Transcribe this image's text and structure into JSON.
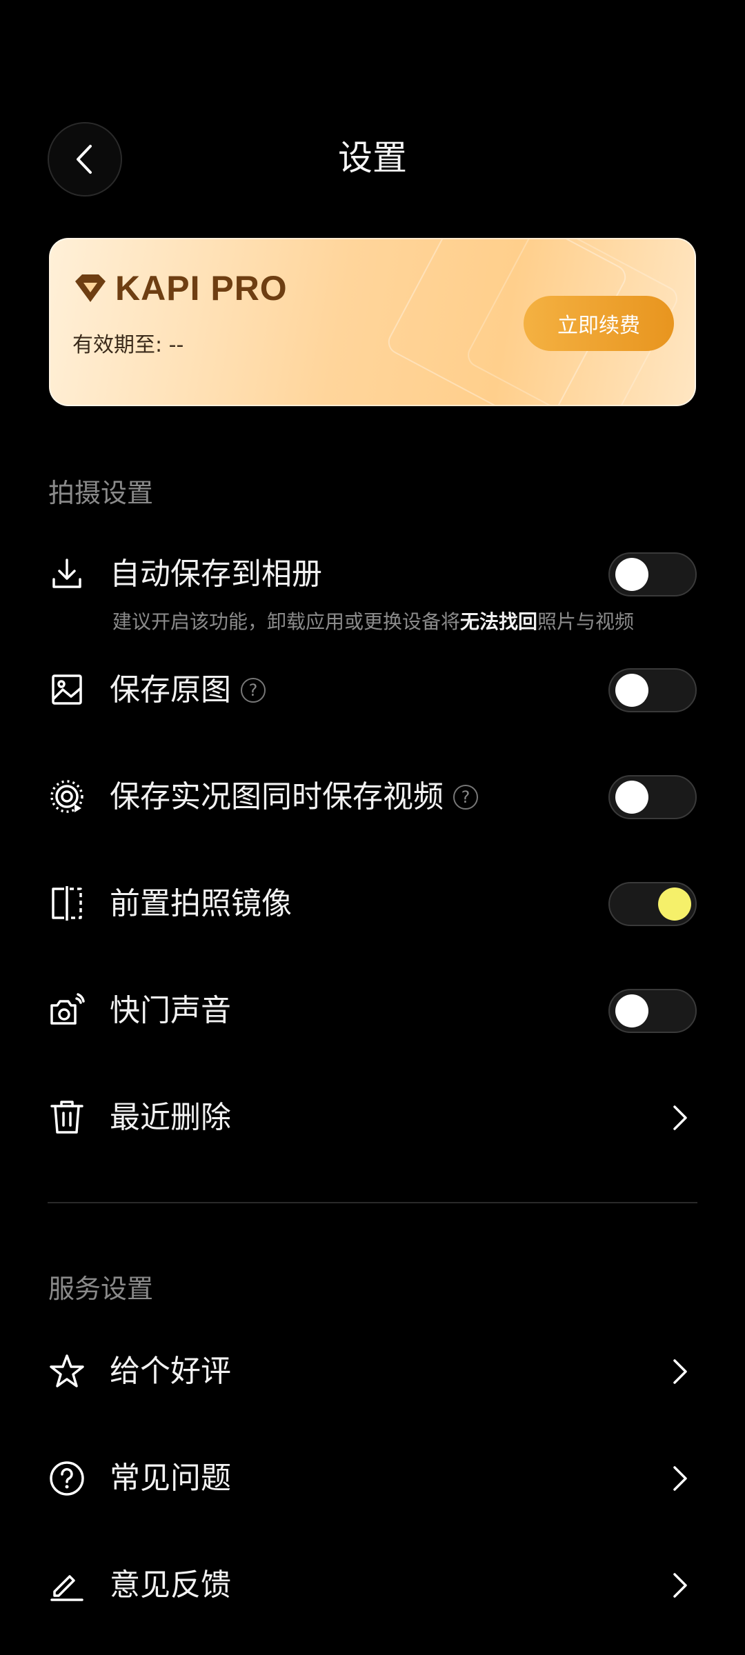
{
  "header": {
    "title": "设置",
    "back_icon": "chevron-left-icon"
  },
  "pro_card": {
    "title": "KAPI PRO",
    "expiry": "有效期至: --",
    "renew_label": "立即续费",
    "colors": {
      "brand": "#6e3e12",
      "button": "#e8951f"
    }
  },
  "sections": {
    "shooting": "拍摄设置",
    "service": "服务设置"
  },
  "shooting_rows": [
    {
      "label": "自动保存到相册",
      "icon": "download-icon",
      "toggle": "off"
    },
    {
      "label": "保存原图",
      "icon": "image-icon",
      "toggle": "off"
    },
    {
      "label": "保存实况图同时保存视频",
      "icon": "live-photo-icon",
      "toggle": "off"
    },
    {
      "label": "前置拍照镜像",
      "icon": "mirror-icon",
      "toggle": "on"
    },
    {
      "label": "快门声音",
      "icon": "camera-sound-icon",
      "toggle": "off"
    },
    {
      "label": "最近删除",
      "icon": "trash-icon"
    }
  ],
  "auto_save_hint": {
    "before": "建议开启该功能，卸载应用或更换设备将",
    "bold": "无法找回",
    "after": "照片与视频"
  },
  "help_mark": "?",
  "service_rows": [
    {
      "label": "给个好评",
      "icon": "star-icon"
    },
    {
      "label": "常见问题",
      "icon": "question-circle-icon"
    },
    {
      "label": "意见反馈",
      "icon": "edit-icon"
    }
  ],
  "colors": {
    "toggle_on": "#f5f06a",
    "background": "#000000"
  }
}
